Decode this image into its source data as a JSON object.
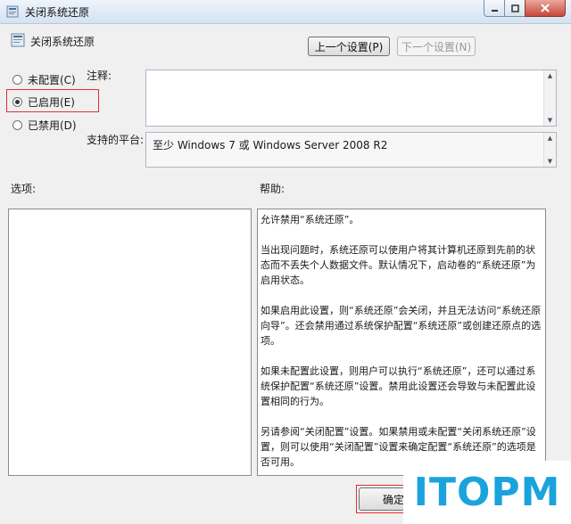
{
  "window": {
    "title": "关闭系统还原"
  },
  "header": {
    "title": "关闭系统还原"
  },
  "nav": {
    "prev_label": "上一个设置(P)",
    "next_label": "下一个设置(N)"
  },
  "state_options": [
    {
      "label": "未配置(C)",
      "checked": false
    },
    {
      "label": "已启用(E)",
      "checked": true
    },
    {
      "label": "已禁用(D)",
      "checked": false
    }
  ],
  "comment": {
    "label": "注释:",
    "value": ""
  },
  "platform": {
    "label": "支持的平台:",
    "value": "至少 Windows 7 或 Windows Server 2008 R2"
  },
  "options_section": {
    "label": "选项:"
  },
  "help_section": {
    "label": "帮助:",
    "paragraphs": [
      "允许禁用“系统还原”。",
      "当出现问题时，系统还原可以使用户将其计算机还原到先前的状态而不丢失个人数据文件。默认情况下，启动卷的“系统还原”为启用状态。",
      "如果启用此设置，则“系统还原”会关闭，并且无法访问“系统还原向导”。还会禁用通过系统保护配置“系统还原”或创建还原点的选项。",
      "如果未配置此设置，则用户可以执行“系统还原”，还可以通过系统保护配置“系统还原”设置。禁用此设置还会导致与未配置此设置相同的行为。",
      "另请参阅“关闭配置”设置。如果禁用或未配置“关闭系统还原”设置，则可以使用“关闭配置”设置来确定配置“系统还原”的选项是否可用。"
    ]
  },
  "footer": {
    "ok_label": "确定"
  },
  "watermark": {
    "text": "ITOPM"
  },
  "colors": {
    "highlight": "#e03030",
    "watermark": "#1aa3dc"
  }
}
